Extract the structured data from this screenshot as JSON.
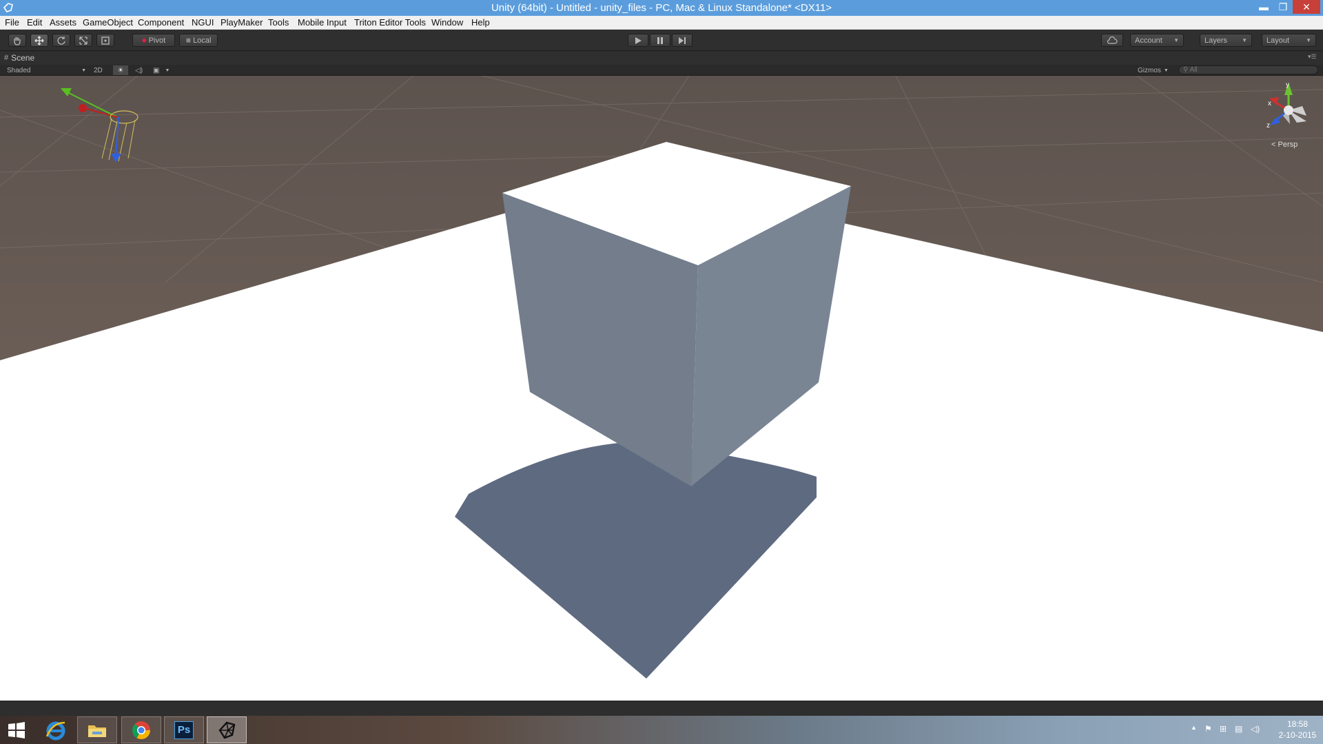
{
  "window": {
    "title": "Unity (64bit) - Untitled - unity_files - PC, Mac & Linux Standalone* <DX11>",
    "minimize": "▬",
    "restore": "❐",
    "close": "✕"
  },
  "menu": {
    "items": [
      "File",
      "Edit",
      "Assets",
      "GameObject",
      "Component",
      "NGUI",
      "PlayMaker",
      "Tools",
      "Mobile Input",
      "Triton Editor Tools",
      "Window",
      "Help"
    ]
  },
  "toolbar": {
    "tools": [
      "hand-tool",
      "move-tool",
      "rotate-tool",
      "scale-tool",
      "rect-tool"
    ],
    "pivot_label": "Pivot",
    "local_label": "Local",
    "account_label": "Account",
    "layers_label": "Layers",
    "layout_label": "Layout"
  },
  "scene": {
    "tab_label": "Scene",
    "shading_mode": "Shaded",
    "mode_2d": "2D",
    "gizmos_label": "Gizmos",
    "search_placeholder": "All",
    "projection_label": "Persp",
    "axis_labels": {
      "y": "y",
      "x": "x",
      "z": "z"
    }
  },
  "taskbar": {
    "apps": [
      "start-button",
      "internet-explorer",
      "file-explorer",
      "chrome",
      "photoshop",
      "unity"
    ],
    "photoshop_label": "Ps",
    "time": "18:58",
    "date": "2-10-2015"
  },
  "colors": {
    "titlebar": "#5b9ddc",
    "editor_bg": "#2f2f2f",
    "sky": "#6f6159",
    "ground": "#ffffff",
    "cube_left": "#737d8c",
    "cube_right": "#7a8594",
    "shadow": "#5e6a80"
  }
}
